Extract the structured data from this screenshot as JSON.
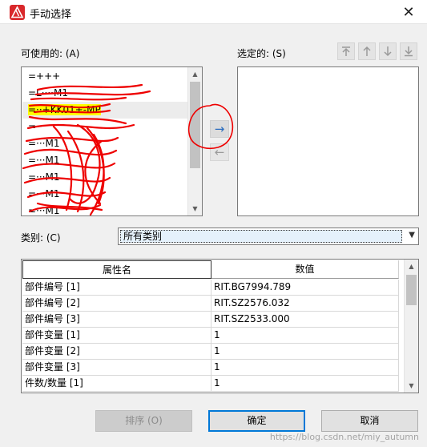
{
  "window": {
    "title": "手动选择",
    "close_glyph": "✕"
  },
  "available": {
    "label": "可使用的: (A)",
    "items": [
      {
        "text": "=+++"
      },
      {
        "text": "=L····M1"
      },
      {
        "text": "=··+KK01+-MP"
      },
      {
        "text": "=··"
      },
      {
        "text": "=···M1"
      },
      {
        "text": "=···M1"
      },
      {
        "text": "=···M1"
      },
      {
        "text": "=···M1"
      },
      {
        "text": "=···M1"
      }
    ],
    "highlight_color": "#ffff00",
    "scribble_color": "#ee0000"
  },
  "selected": {
    "label": "选定的: (S)",
    "items": []
  },
  "toolbar": {
    "icons": [
      "move-top-icon",
      "move-up-icon",
      "move-down-icon",
      "move-bottom-icon"
    ]
  },
  "transfer": {
    "add_icon": "arrow-right-icon",
    "remove_icon": "arrow-left-icon",
    "add_glyph": "→",
    "remove_glyph": "←"
  },
  "category": {
    "label": "类别: (C)",
    "value": "所有类别"
  },
  "properties": {
    "columns": [
      "属性名",
      "数值"
    ],
    "rows": [
      [
        "部件编号 [1]",
        "RIT.BG7994.789"
      ],
      [
        "部件编号 [2]",
        "RIT.SZ2576.032"
      ],
      [
        "部件编号 [3]",
        "RIT.SZ2533.000"
      ],
      [
        "部件变量 [1]",
        "1"
      ],
      [
        "部件变量 [2]",
        "1"
      ],
      [
        "部件变量 [3]",
        "1"
      ],
      [
        "件数/数量 [1]",
        "1"
      ]
    ]
  },
  "buttons": {
    "sort": "排序 (O)",
    "ok": "确定",
    "cancel": "取消"
  },
  "watermark": "https://blog.csdn.net/miy_autumn",
  "colors": {
    "accent": "#0078d7",
    "link_blue": "#2a6cbf"
  }
}
